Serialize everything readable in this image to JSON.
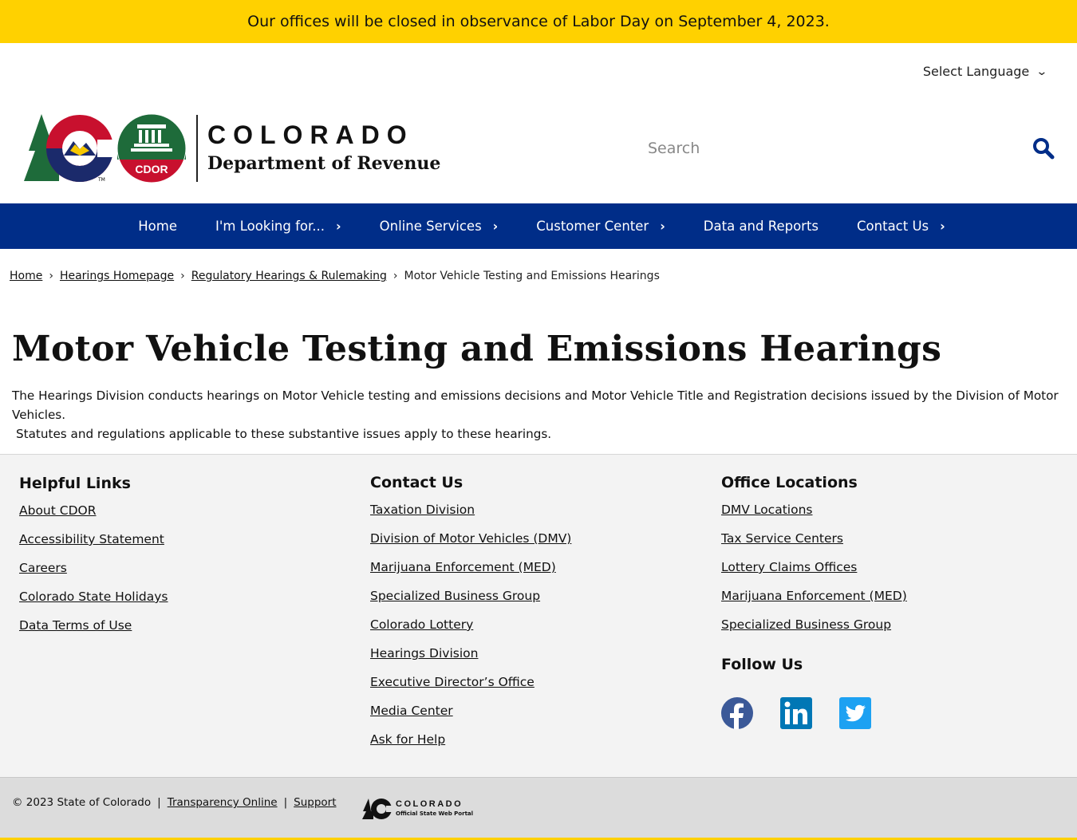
{
  "alert": {
    "text": "Our offices will be closed in observance of Labor Day on September 4, 2023."
  },
  "language": {
    "label": "Select Language"
  },
  "logo": {
    "state": "COLORADO",
    "dept": "Department of Revenue",
    "badge": "CDOR",
    "tm": "TM"
  },
  "search": {
    "placeholder": "Search"
  },
  "nav": {
    "items": [
      {
        "label": "Home",
        "has_caret": false
      },
      {
        "label": "I'm Looking for...",
        "has_caret": true
      },
      {
        "label": "Online Services",
        "has_caret": true
      },
      {
        "label": "Customer Center",
        "has_caret": true
      },
      {
        "label": "Data and Reports",
        "has_caret": false
      },
      {
        "label": "Contact Us",
        "has_caret": true
      }
    ]
  },
  "breadcrumb": {
    "items": [
      "Home",
      "Hearings Homepage",
      "Regulatory Hearings & Rulemaking"
    ],
    "current": "Motor Vehicle Testing and Emissions Hearings"
  },
  "page": {
    "title": "Motor Vehicle Testing and Emissions Hearings",
    "description_line1": "The Hearings Division conducts hearings on Motor Vehicle testing and emissions decisions and Motor Vehicle Title and Registration decisions issued by the Division of Motor Vehicles.",
    "description_line2": "Statutes and regulations applicable to these substantive issues apply to these hearings."
  },
  "footer": {
    "helpful": {
      "title": "Helpful Links",
      "links": [
        "About CDOR",
        "Accessibility Statement",
        "Careers",
        "Colorado State Holidays",
        "Data Terms of Use"
      ]
    },
    "contact": {
      "title": "Contact Us",
      "links": [
        "Taxation Division",
        "Division of Motor Vehicles (DMV)",
        "Marijuana Enforcement (MED)",
        "Specialized Business Group",
        "Colorado Lottery",
        "Hearings Division",
        "Executive Director’s Office",
        "Media Center",
        "Ask for Help"
      ]
    },
    "offices": {
      "title": "Office Locations",
      "links": [
        "DMV Locations",
        "Tax Service Centers",
        "Lottery Claims Offices",
        "Marijuana Enforcement (MED)",
        "Specialized Business Group"
      ]
    },
    "follow": {
      "title": "Follow Us",
      "icons": [
        "facebook-icon",
        "linkedin-icon",
        "twitter-icon"
      ]
    }
  },
  "bottom": {
    "copyright": "© 2023 State of Colorado",
    "sep": "|",
    "transparency": "Transparency Online",
    "support": "Support",
    "portal_name": "COLORADO",
    "portal_sub": "Official State Web Portal"
  },
  "colors": {
    "alert_yellow": "#FFD100",
    "nav_blue": "#002D88",
    "footer_bg": "#f3f3f3",
    "facebook_blue": "#3B5998",
    "linkedin_blue": "#0077B5",
    "twitter_blue": "#1DA1F2"
  }
}
